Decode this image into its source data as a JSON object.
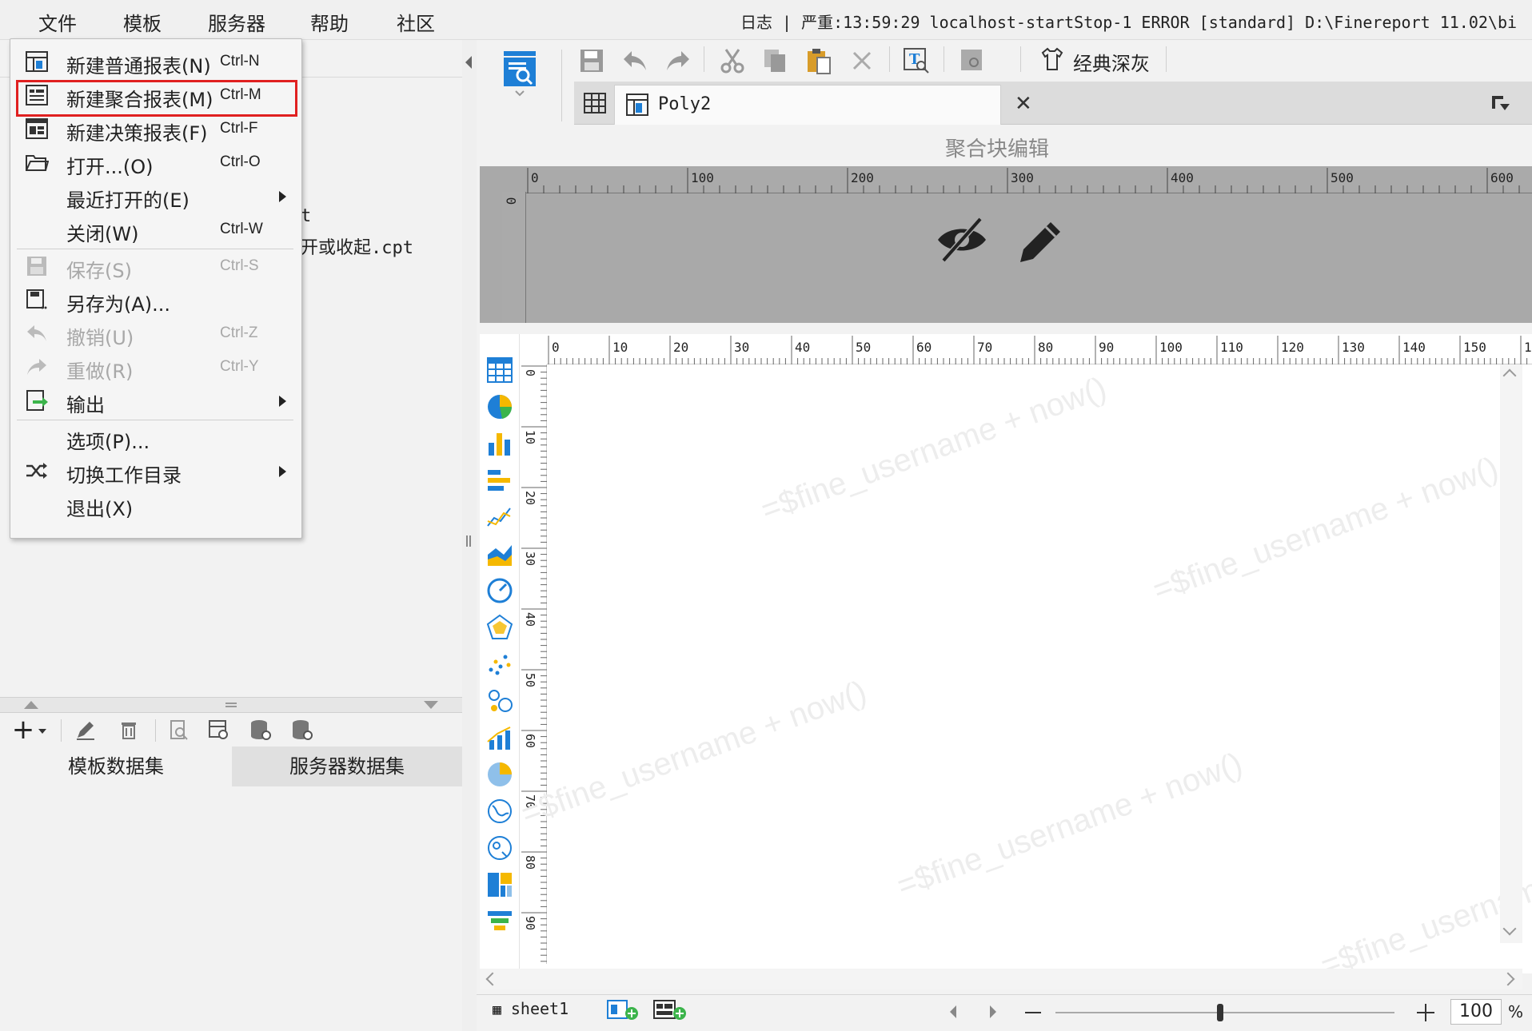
{
  "menubar": {
    "items": [
      {
        "label": "文件"
      },
      {
        "label": "模板"
      },
      {
        "label": "服务器"
      },
      {
        "label": "帮助"
      },
      {
        "label": "社区"
      }
    ],
    "status_line": "日志 | 严重:13:59:29 localhost-startStop-1 ERROR [standard] D:\\Finereport 11.02\\bi"
  },
  "file_menu": {
    "items": [
      {
        "label": "新建普通报表(N)",
        "shortcut": "Ctrl-N",
        "icon": "new-report-icon"
      },
      {
        "label": "新建聚合报表(M)",
        "shortcut": "Ctrl-M",
        "icon": "new-poly-report-icon"
      },
      {
        "label": "新建决策报表(F)",
        "shortcut": "Ctrl-F",
        "icon": "new-decision-report-icon"
      },
      {
        "label": "打开...(O)",
        "shortcut": "Ctrl-O",
        "icon": "folder-open-icon"
      },
      {
        "label": "最近打开的(E)",
        "shortcut": "",
        "icon": ""
      },
      {
        "label": "关闭(W)",
        "shortcut": "Ctrl-W",
        "icon": ""
      },
      {
        "label": "保存(S)",
        "shortcut": "Ctrl-S",
        "icon": "save-icon"
      },
      {
        "label": "另存为(A)...",
        "shortcut": "",
        "icon": "save-as-icon"
      },
      {
        "label": "撤销(U)",
        "shortcut": "Ctrl-Z",
        "icon": "undo-icon"
      },
      {
        "label": "重做(R)",
        "shortcut": "Ctrl-Y",
        "icon": "redo-icon"
      },
      {
        "label": "输出",
        "shortcut": "",
        "icon": "export-icon"
      },
      {
        "label": "选项(P)...",
        "shortcut": "",
        "icon": ""
      },
      {
        "label": "切换工作目录",
        "shortcut": "",
        "icon": "shuffle-icon"
      },
      {
        "label": "退出(X)",
        "shortcut": "",
        "icon": ""
      }
    ]
  },
  "left_pane": {
    "partial_text_1": "t",
    "partial_text_2": "开或收起.cpt"
  },
  "dataset_tabs": [
    {
      "label": "模板数据集"
    },
    {
      "label": "服务器数据集"
    }
  ],
  "toolbar": {
    "theme_label": "经典深灰"
  },
  "template_tab": {
    "label": "Poly2"
  },
  "panel_title": "聚合块编辑",
  "poly_ruler": {
    "h_ticks": [
      "0",
      "100",
      "200",
      "300",
      "400",
      "500",
      "600"
    ],
    "v_ticks": [
      "0"
    ]
  },
  "sheet_ruler": {
    "h_ticks": [
      "0",
      "10",
      "20",
      "30",
      "40",
      "50",
      "60",
      "70",
      "80",
      "90",
      "100",
      "110",
      "120",
      "130",
      "140",
      "150",
      "1"
    ],
    "v_ticks": [
      "0",
      "10",
      "20",
      "30",
      "40",
      "50",
      "60",
      "70",
      "80",
      "90"
    ]
  },
  "watermark_text": "=$fine_username + now()",
  "bottom_bar": {
    "sheet_tab": "sheet1",
    "zoom_value": "100",
    "zoom_unit": "%"
  },
  "colors": {
    "highlight": "#e02020",
    "accent_blue": "#1e7fd6",
    "poly_bg": "#a9a9a9"
  }
}
